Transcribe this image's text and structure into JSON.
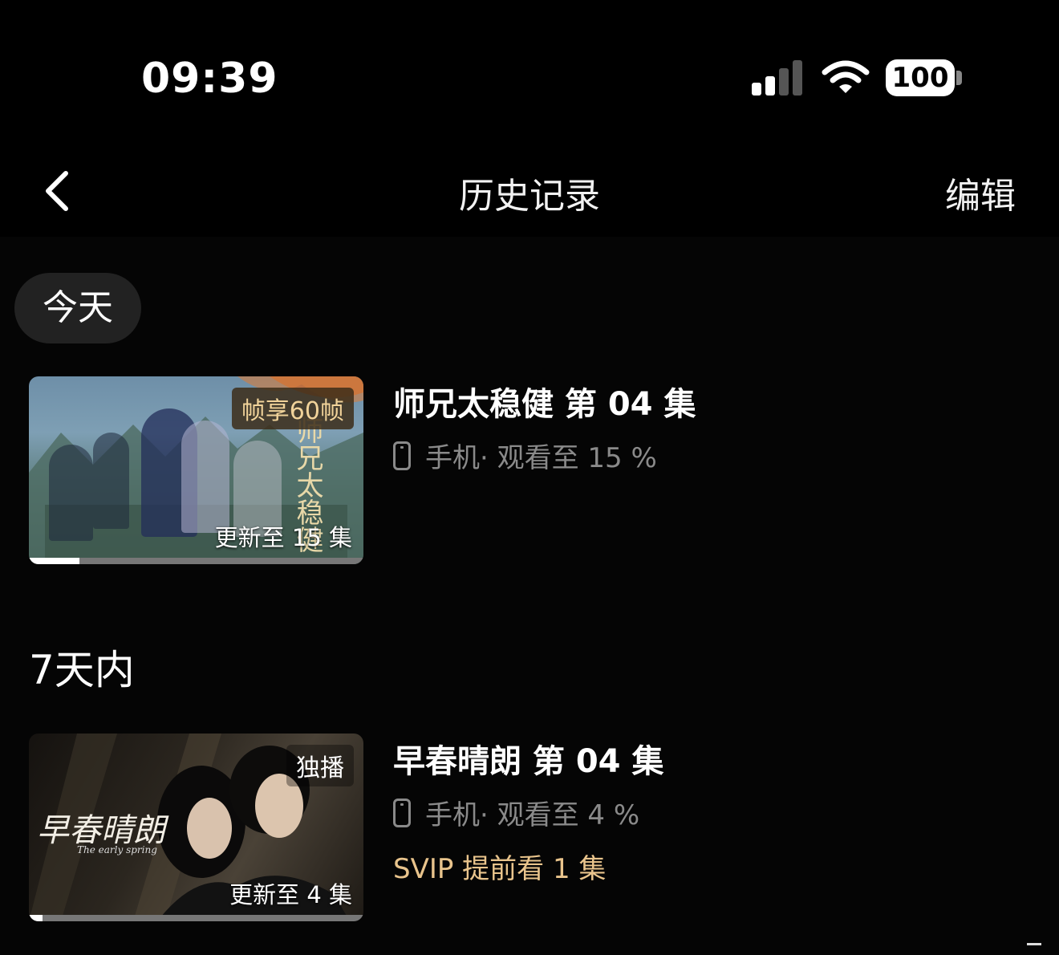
{
  "status_bar": {
    "time": "09:39",
    "battery": "100"
  },
  "nav": {
    "title": "历史记录",
    "edit_label": "编辑"
  },
  "sections": [
    {
      "label": "今天",
      "items": [
        {
          "title": "师兄太稳健 第 04 集",
          "device": "手机",
          "progress_text": "· 观看至 15 %",
          "badge_top": "帧享60帧",
          "badge_bottom": "更新至 15 集",
          "poster_text": "师兄太稳健",
          "watched_fraction": 0.15
        }
      ]
    },
    {
      "label": "7天内",
      "items": [
        {
          "title": "早春晴朗 第 04 集",
          "device": "手机",
          "progress_text": "· 观看至 4 %",
          "badge_top": "独播",
          "badge_bottom": "更新至 4 集",
          "poster_text": "早春晴朗",
          "poster_subtext": "The early spring",
          "svip_text": "SVIP 提前看 1 集",
          "watched_fraction": 0.04
        }
      ]
    }
  ],
  "colors": {
    "background": "#000000",
    "gold": "#e9c48c",
    "muted": "#8a8a8a"
  },
  "icons": [
    "back-chevron-icon",
    "signal-icon",
    "wifi-icon",
    "battery-icon",
    "phone-icon"
  ]
}
